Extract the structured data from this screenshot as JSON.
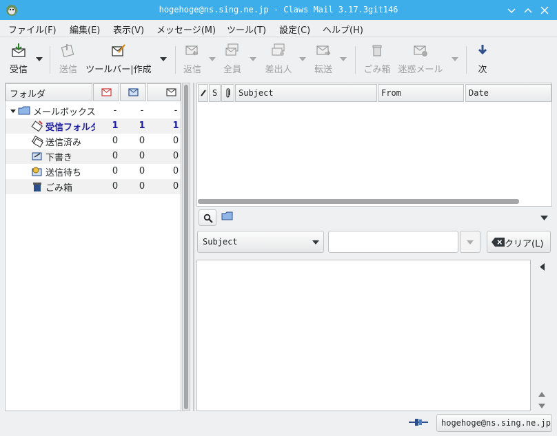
{
  "window": {
    "title": "hogehoge@ns.sing.ne.jp - Claws Mail 3.17.3git146"
  },
  "menu": [
    "ファイル(F)",
    "編集(E)",
    "表示(V)",
    "メッセージ(M)",
    "ツール(T)",
    "設定(C)",
    "ヘルプ(H)"
  ],
  "toolbar": {
    "receive": "受信",
    "send": "送信",
    "compose": "ツールバー|作成",
    "reply": "返信",
    "reply_all": "全員",
    "reply_sender": "差出人",
    "forward": "転送",
    "trash": "ごみ箱",
    "spam": "迷惑メール",
    "next": "次"
  },
  "folder_pane": {
    "header": "フォルダ",
    "rows": [
      {
        "name": "メールボックス",
        "new": "-",
        "unread": "-",
        "total": "-"
      },
      {
        "name": "受信フォルダ",
        "new": "1",
        "unread": "1",
        "total": "1"
      },
      {
        "name": "送信済み",
        "new": "0",
        "unread": "0",
        "total": "0"
      },
      {
        "name": "下書き",
        "new": "0",
        "unread": "0",
        "total": "0"
      },
      {
        "name": "送信待ち",
        "new": "0",
        "unread": "0",
        "total": "0"
      },
      {
        "name": "ごみ箱",
        "new": "0",
        "unread": "0",
        "total": "0"
      }
    ]
  },
  "message_list": {
    "columns": {
      "status": "S",
      "subject": "Subject",
      "from": "From",
      "date": "Date"
    }
  },
  "search": {
    "field": "Subject",
    "value": "",
    "clear_label": "クリア(L)"
  },
  "status": {
    "account": "hogehoge@ns.sing.ne.jp"
  },
  "colors": {
    "titlebar": "#3daee9",
    "unread_folder": "#1c1ca3"
  }
}
